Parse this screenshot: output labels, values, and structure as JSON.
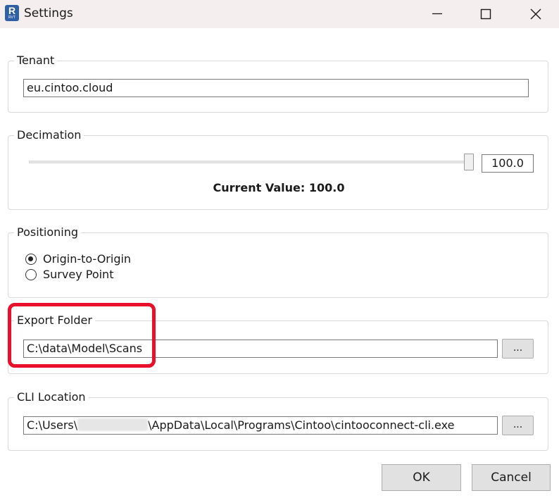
{
  "window": {
    "title": "Settings",
    "app_icon": {
      "name": "revit-icon",
      "letter": "R",
      "sub": "RVT"
    },
    "controls": [
      "minimize-icon",
      "maximize-icon",
      "close-icon"
    ]
  },
  "tenant": {
    "label": "Tenant",
    "value": "eu.cintoo.cloud"
  },
  "decimation": {
    "label": "Decimation",
    "slider_value": 100.0,
    "slider_max": 100.0,
    "value_text": "100.0",
    "current_value_text": "Current Value: 100.0"
  },
  "positioning": {
    "label": "Positioning",
    "options": [
      {
        "label": "Origin-to-Origin",
        "checked": true
      },
      {
        "label": "Survey Point",
        "checked": false
      }
    ]
  },
  "export_folder": {
    "label": "Export Folder",
    "value": "C:\\data\\Model\\Scans",
    "browse_label": "...",
    "highlight_color": "#e8102a"
  },
  "cli_location": {
    "label": "CLI Location",
    "value_prefix": "C:\\Users\\",
    "value_suffix": "\\AppData\\Local\\Programs\\Cintoo\\cintooconnect-cli.exe",
    "browse_label": "..."
  },
  "footer": {
    "ok_label": "OK",
    "cancel_label": "Cancel"
  },
  "colors": {
    "titlebar": "#f5eeee",
    "accent": "#0078d4",
    "highlight": "#e8102a"
  }
}
